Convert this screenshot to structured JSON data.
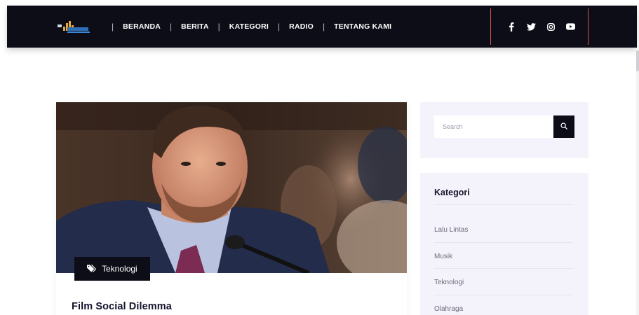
{
  "nav": {
    "items": [
      {
        "label": "BERANDA"
      },
      {
        "label": "BERITA"
      },
      {
        "label": "KATEGORI"
      },
      {
        "label": "RADIO"
      },
      {
        "label": "TENTANG KAMI"
      }
    ],
    "separator": "|",
    "social_icons": [
      "facebook-icon",
      "twitter-icon",
      "instagram-icon",
      "youtube-icon"
    ]
  },
  "article": {
    "category": "Teknologi",
    "title": "Film Social Dilemma"
  },
  "sidebar": {
    "search_placeholder": "Search",
    "categories_heading": "Kategori",
    "categories": [
      {
        "label": "Lalu Lintas"
      },
      {
        "label": "Musik"
      },
      {
        "label": "Teknologi"
      },
      {
        "label": "Olahraga"
      }
    ]
  },
  "colors": {
    "navbar_bg": "#0d0d18",
    "accent_line": "#d9534f",
    "sidebar_bg": "#f4f3fb"
  }
}
